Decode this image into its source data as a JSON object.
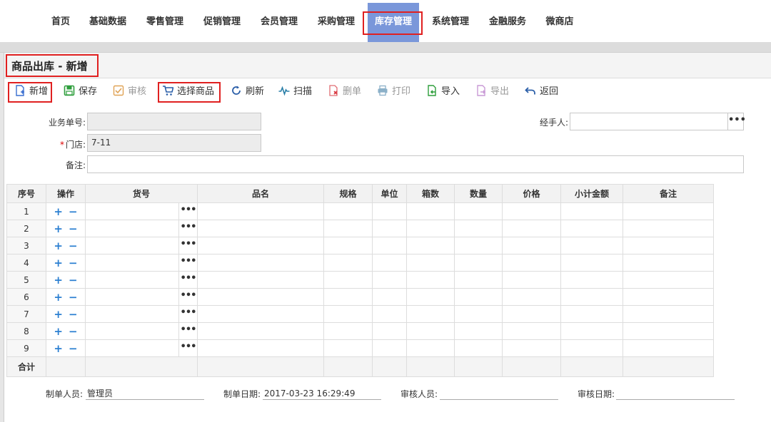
{
  "nav": {
    "items": [
      "首页",
      "基础数据",
      "零售管理",
      "促销管理",
      "会员管理",
      "采购管理",
      "库存管理",
      "系统管理",
      "金融服务",
      "微商店"
    ],
    "active": "库存管理",
    "active_color": "#7a97da"
  },
  "page": {
    "title": "商品出库 - 新增"
  },
  "toolbar": {
    "new": "新增",
    "save": "保存",
    "audit": "审核",
    "select_goods": "选择商品",
    "refresh": "刷新",
    "scan": "扫描",
    "delete": "删单",
    "print": "打印",
    "import": "导入",
    "export": "导出",
    "back": "返回"
  },
  "form": {
    "order_no_label": "业务单号:",
    "order_no_value": "",
    "store_label": "门店:",
    "store_value": "7-11",
    "note_label": "备注:",
    "note_value": "",
    "handler_label": "经手人:",
    "handler_value": "",
    "dots": "•••"
  },
  "grid": {
    "headers": [
      "序号",
      "操作",
      "货号",
      "品名",
      "规格",
      "单位",
      "箱数",
      "数量",
      "价格",
      "小计金额",
      "备注"
    ],
    "rows": [
      "1",
      "2",
      "3",
      "4",
      "5",
      "6",
      "7",
      "8",
      "9"
    ],
    "plus": "+",
    "minus": "−",
    "dots": "•••",
    "total_label": "合计"
  },
  "footer": {
    "creator_label": "制单人员:",
    "creator_value": "管理员",
    "created_label": "制单日期:",
    "created_value": "2017-03-23 16:29:49",
    "auditor_label": "审核人员:",
    "auditor_value": "",
    "audit_date_label": "审核日期:",
    "audit_date_value": ""
  },
  "colors": {
    "highlight": "#e02020",
    "accent": "#2b7fd1"
  }
}
